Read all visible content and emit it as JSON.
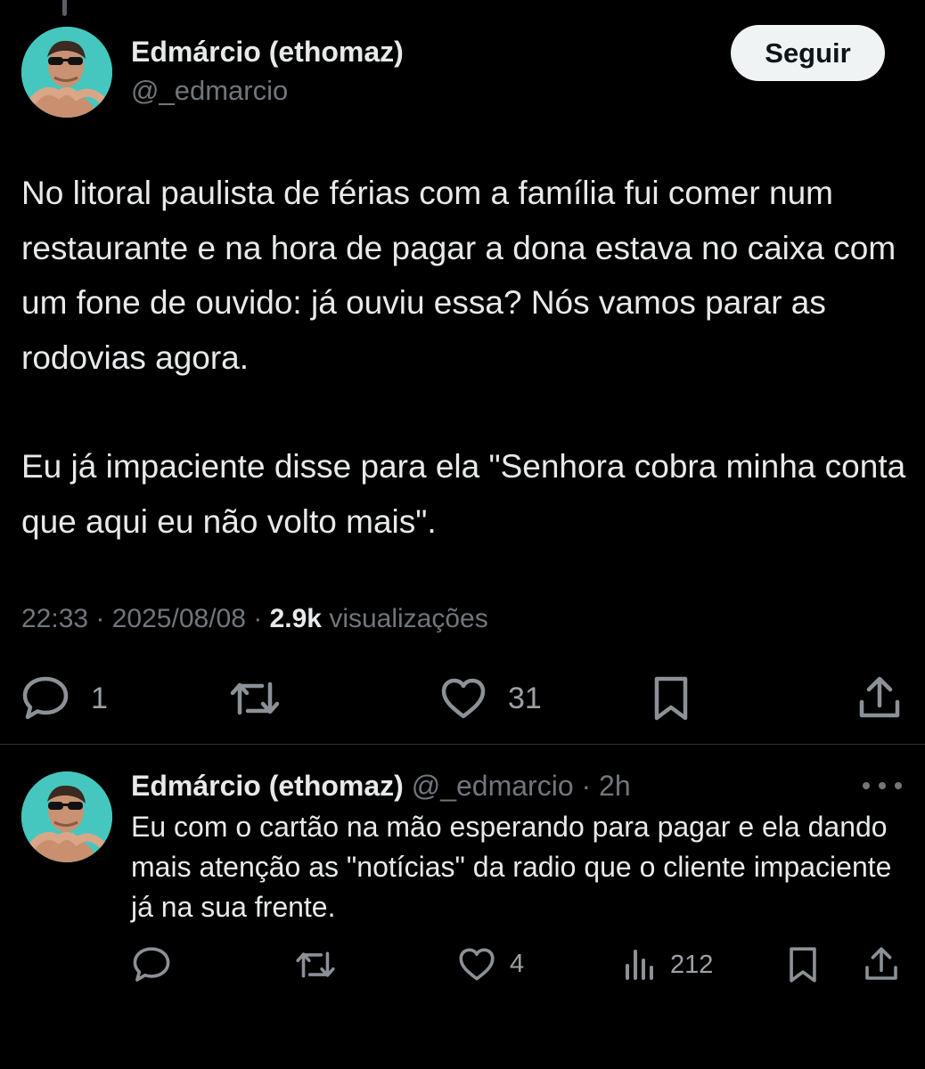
{
  "main_tweet": {
    "display_name": "Edmárcio (ethomaz)",
    "handle": "@_edmarcio",
    "follow_label": "Seguir",
    "paragraphs": [
      "No litoral paulista de férias com a família fui comer num restaurante e na hora de pagar a dona estava no caixa com um fone de ouvido: já ouviu essa? Nós vamos parar as rodovias agora.",
      "Eu já impaciente disse para ela \"Senhora cobra minha conta que aqui eu não volto mais\"."
    ],
    "time": "22:33",
    "separator": "·",
    "date": "2025/08/08",
    "views_count": "2.9k",
    "views_label": "visualizações",
    "actions": {
      "reply_count": "1",
      "retweet_count": "",
      "like_count": "31"
    },
    "icons": [
      "reply-icon",
      "retweet-icon",
      "like-icon",
      "bookmark-icon",
      "share-icon"
    ]
  },
  "reply_tweet": {
    "display_name": "Edmárcio (ethomaz)",
    "handle": "@_edmarcio",
    "separator": "·",
    "time": "2h",
    "text": "Eu com o cartão na mão esperando para pagar e ela dando mais atenção as \"notícias\" da radio que o cliente impaciente já na sua frente.",
    "actions": {
      "reply_count": "",
      "retweet_count": "",
      "like_count": "4",
      "views_count": "212"
    },
    "icons": [
      "reply-icon",
      "retweet-icon",
      "like-icon",
      "views-icon",
      "bookmark-icon",
      "share-icon",
      "more-icon"
    ]
  },
  "colors": {
    "background": "#000000",
    "primary_text": "#e7e9ea",
    "secondary_text": "#71767b",
    "divider": "#2f3336",
    "follow_button_bg": "#eff3f4",
    "follow_button_text": "#0f1419"
  }
}
